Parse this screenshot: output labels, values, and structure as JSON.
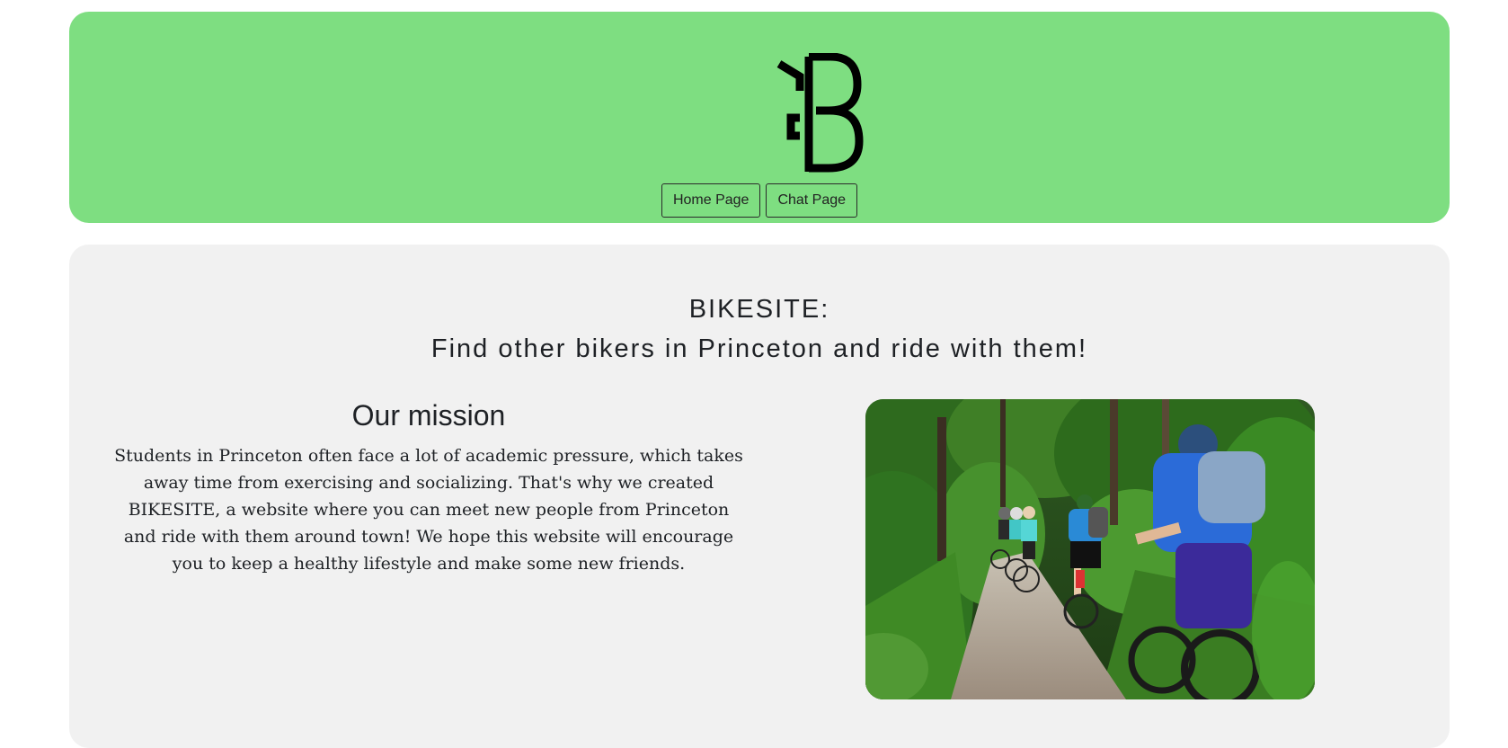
{
  "header": {
    "logo_icon": "bike-b-logo-icon",
    "background_color": "#7ede81",
    "nav": {
      "home_label": "Home Page",
      "chat_label": "Chat Page"
    }
  },
  "main": {
    "background_color": "#f1f1f1",
    "headline_line1": "BIKESITE:",
    "headline_line2": "Find other bikers in Princeton and ride with them!",
    "mission_title": "Our mission",
    "mission_text": "Students in Princeton often face a lot of academic pressure, which takes away time from exercising and socializing. That's why we created BIKESITE, a website where you can meet new people from Princeton and ride with them around town! We hope this website will encourage you to keep a healthy lifestyle and make some new friends.",
    "photo_subject": "cyclists-on-forest-path-image"
  }
}
